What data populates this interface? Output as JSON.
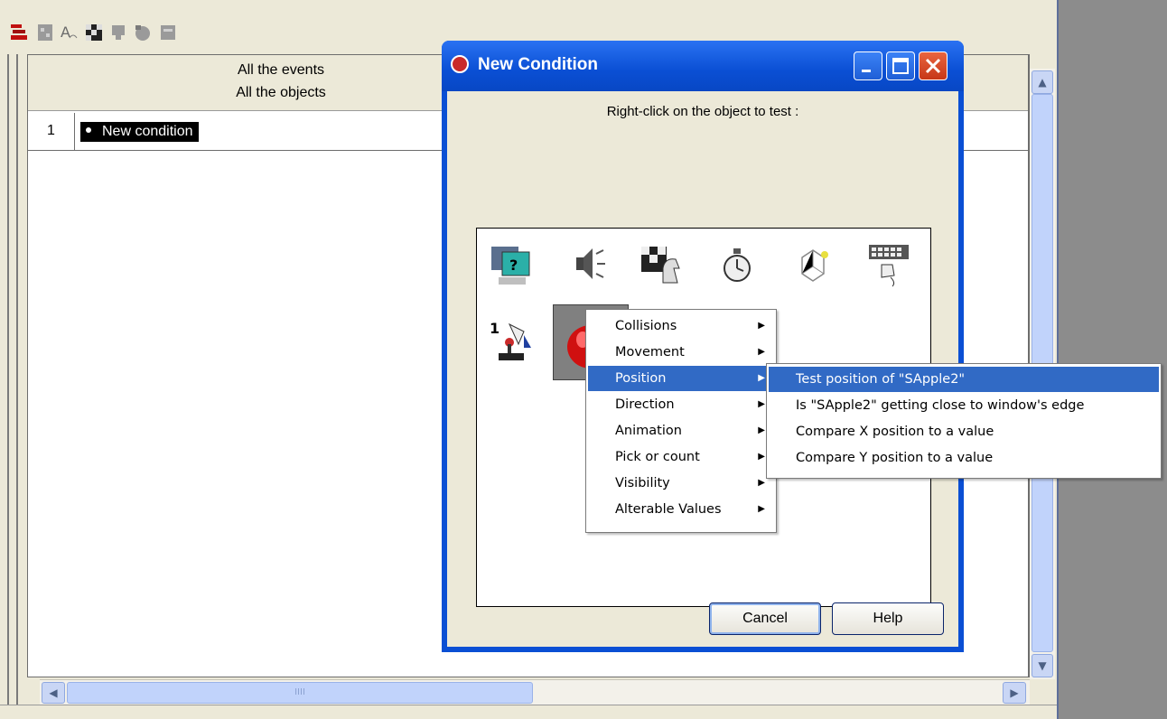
{
  "editor": {
    "header_line1": "All the events",
    "header_line2": "All the objects",
    "rows": [
      {
        "number": "1",
        "condition": "New condition"
      }
    ]
  },
  "dialog": {
    "title": "New Condition",
    "prompt": "Right-click on the object to test :",
    "cancel_label": "Cancel",
    "help_label": "Help",
    "joystick_number": "1"
  },
  "context_menu": {
    "items": [
      {
        "label": "Collisions"
      },
      {
        "label": "Movement"
      },
      {
        "label": "Position"
      },
      {
        "label": "Direction"
      },
      {
        "label": "Animation"
      },
      {
        "label": "Pick or count"
      },
      {
        "label": "Visibility"
      },
      {
        "label": "Alterable Values"
      }
    ]
  },
  "submenu": {
    "items": [
      {
        "label": "Test position of \"SApple2\""
      },
      {
        "label": "Is \"SApple2\" getting close to window's edge"
      },
      {
        "label": "Compare X position to a value"
      },
      {
        "label": "Compare Y position to a value"
      }
    ]
  },
  "scrollbar": {
    "grip": "IIII"
  },
  "colors": {
    "titlebar": "#0a4fd4",
    "selection": "#316ac5",
    "close": "#c63718"
  }
}
